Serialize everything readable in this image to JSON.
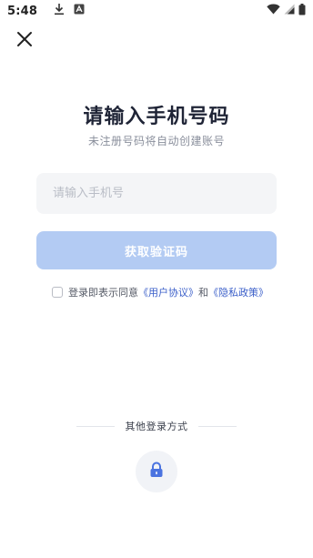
{
  "status_bar": {
    "time": "5:48",
    "left_icons": [
      "download-icon",
      "app-notification-icon"
    ],
    "right_icons": [
      "wifi-icon",
      "cell-signal-icon",
      "battery-icon"
    ]
  },
  "header": {
    "close_icon": "close-icon"
  },
  "login": {
    "title": "请输入手机号码",
    "subtitle": "未注册号码将自动创建账号",
    "phone_placeholder": "请输入手机号",
    "phone_value": "",
    "get_code_label": "获取验证码",
    "agreement": {
      "prefix": "登录即表示同意",
      "user_agreement": "《用户协议》",
      "conjunction": "和",
      "privacy_policy": "《隐私政策》",
      "checked": false
    }
  },
  "other_login": {
    "label": "其他登录方式",
    "options": [
      "lock-icon"
    ]
  },
  "colors": {
    "title": "#1f2436",
    "button_disabled": "#b3cbf3",
    "link": "#3b5fc9",
    "input_bg": "#f4f5f7",
    "lock_icon": "#4a73e0"
  }
}
